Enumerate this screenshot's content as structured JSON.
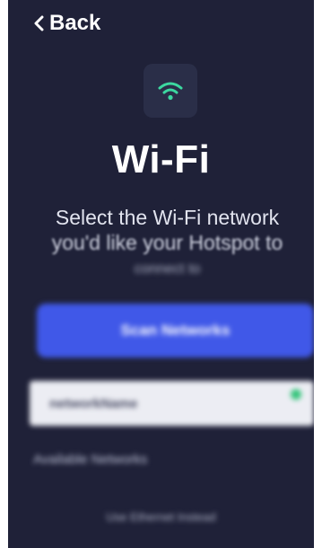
{
  "nav": {
    "back_label": "Back"
  },
  "header": {
    "icon": "wifi-icon",
    "title": "Wi-Fi",
    "subtitle_line1": "Select the Wi-Fi network",
    "subtitle_line2": "you'd like your Hotspot to",
    "subtitle_line3": "connect to"
  },
  "actions": {
    "scan_label": "Scan Networks"
  },
  "network_field": {
    "value": "networkName"
  },
  "available": {
    "label": "Available Networks"
  },
  "footer": {
    "ethernet_label": "Use Ethernet Instead"
  },
  "colors": {
    "background": "#1f2138",
    "icon_tile": "#2a2e48",
    "wifi_icon": "#3cd8a0",
    "primary_button": "#4058e8",
    "field": "#ecedf3",
    "status_dot": "#34c47a"
  }
}
